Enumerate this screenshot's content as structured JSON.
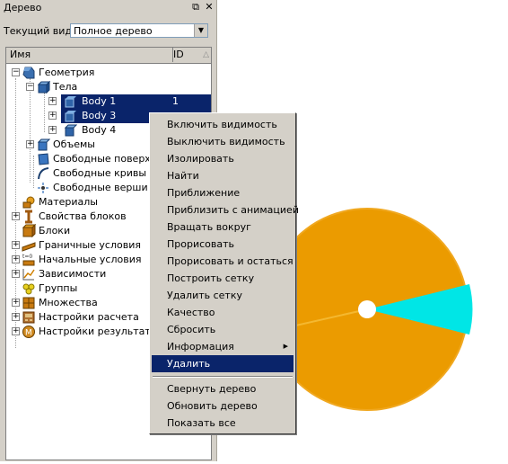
{
  "panel": {
    "title": "Дерево",
    "pin_glyph": "⧉",
    "close_glyph": "✕",
    "view_label": "Текущий вид",
    "view_value": "Полное дерево",
    "columns": {
      "name": "Имя",
      "id": "ID"
    }
  },
  "tree": {
    "geometry": "Геометрия",
    "bodies": "Тела",
    "body1": "Body 1",
    "body1_id": "1",
    "body3": "Body 3",
    "body4": "Body 4",
    "volumes": "Объемы",
    "free_surfaces": "Свободные поверх",
    "free_curves": "Свободные кривы",
    "free_vertices": "Свободные верши",
    "materials": "Материалы",
    "block_props": "Свойства блоков",
    "blocks": "Блоки",
    "boundary_conditions": "Граничные условия",
    "initial_conditions": "Начальные условия",
    "dependencies": "Зависимости",
    "groups": "Группы",
    "sets": "Множества",
    "calc_settings": "Настройки расчета",
    "result_settings": "Настройки результато"
  },
  "menu": {
    "show": "Включить видимость",
    "hide": "Выключить видимость",
    "isolate": "Изолировать",
    "find": "Найти",
    "zoom": "Приближение",
    "zoom_anim": "Приблизить с анимацией",
    "rotate": "Вращать вокруг",
    "draw": "Прорисовать",
    "draw_stay": "Прорисовать и остаться",
    "build_mesh": "Построить сетку",
    "delete_mesh": "Удалить сетку",
    "quality": "Качество",
    "reset": "Сбросить",
    "info": "Информация",
    "delete": "Удалить",
    "collapse": "Свернуть дерево",
    "refresh": "Обновить дерево",
    "show_all": "Показать все"
  },
  "colors": {
    "orange": "#eb9b00",
    "cyan": "#00e6e6",
    "selection": "#0a246a"
  }
}
